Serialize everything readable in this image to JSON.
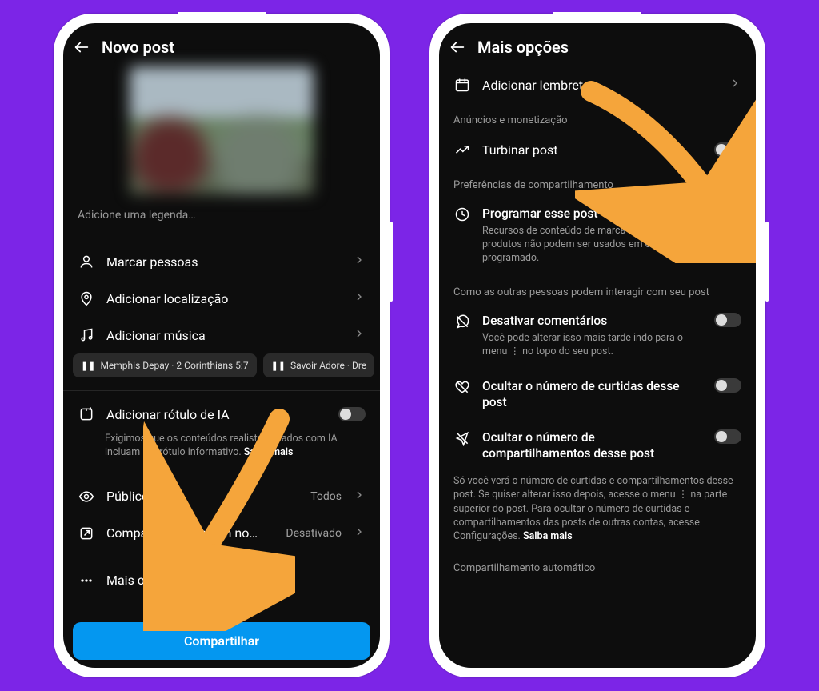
{
  "colors": {
    "purple": "#7c25e7",
    "accent": "#0497f0",
    "arrow": "#f5a53b"
  },
  "left": {
    "header": {
      "title": "Novo post"
    },
    "caption_placeholder": "Adicione uma legenda…",
    "rows": {
      "tag_people": "Marcar pessoas",
      "add_location": "Adicionar localização",
      "add_music": "Adicionar música",
      "music_chips": [
        "Memphis Depay · 2 Corinthians 5:7",
        "Savoir Adore · Dre"
      ],
      "ai_label_title": "Adicionar rótulo de IA",
      "ai_label_desc_1": "Exigimos que os conteúdos realistas criados com IA incluam um rótulo informativo.",
      "ai_label_more": "Saiba mais",
      "audience_label": "Público",
      "audience_value": "Todos",
      "crosspost_label": "Compartilhar também no…",
      "crosspost_value": "Desativado",
      "more_options": "Mais opções"
    },
    "share_button": "Compartilhar"
  },
  "right": {
    "header": {
      "title": "Mais opções"
    },
    "add_reminder": "Adicionar lembrete",
    "section_ads": "Anúncios e monetização",
    "boost": "Turbinar post",
    "section_share": "Preferências de compartilhamento",
    "schedule_title": "Programar esse post",
    "schedule_desc": "Recursos de conteúdo de marca e etiquetas de produtos não podem ser usados em conteúdo programado.",
    "section_interact": "Como as outras pessoas podem interagir com seu post",
    "disable_comments_title": "Desativar comentários",
    "disable_comments_desc": "Você pode alterar isso mais tarde indo para o menu ⋮ no topo do seu post.",
    "hide_likes_title": "Ocultar o número de curtidas desse post",
    "hide_shares_title": "Ocultar o número de compartilhamentos desse post",
    "hide_footnote": "Só você verá o número de curtidas e compartilhamentos desse post. Se quiser alterar isso depois, acesse o menu ⋮ na parte superior do post. Para ocultar o número de curtidas e compartilhamentos das posts de outras contas, acesse Configurações.",
    "learn_more": "Saiba mais",
    "section_auto": "Compartilhamento automático"
  }
}
